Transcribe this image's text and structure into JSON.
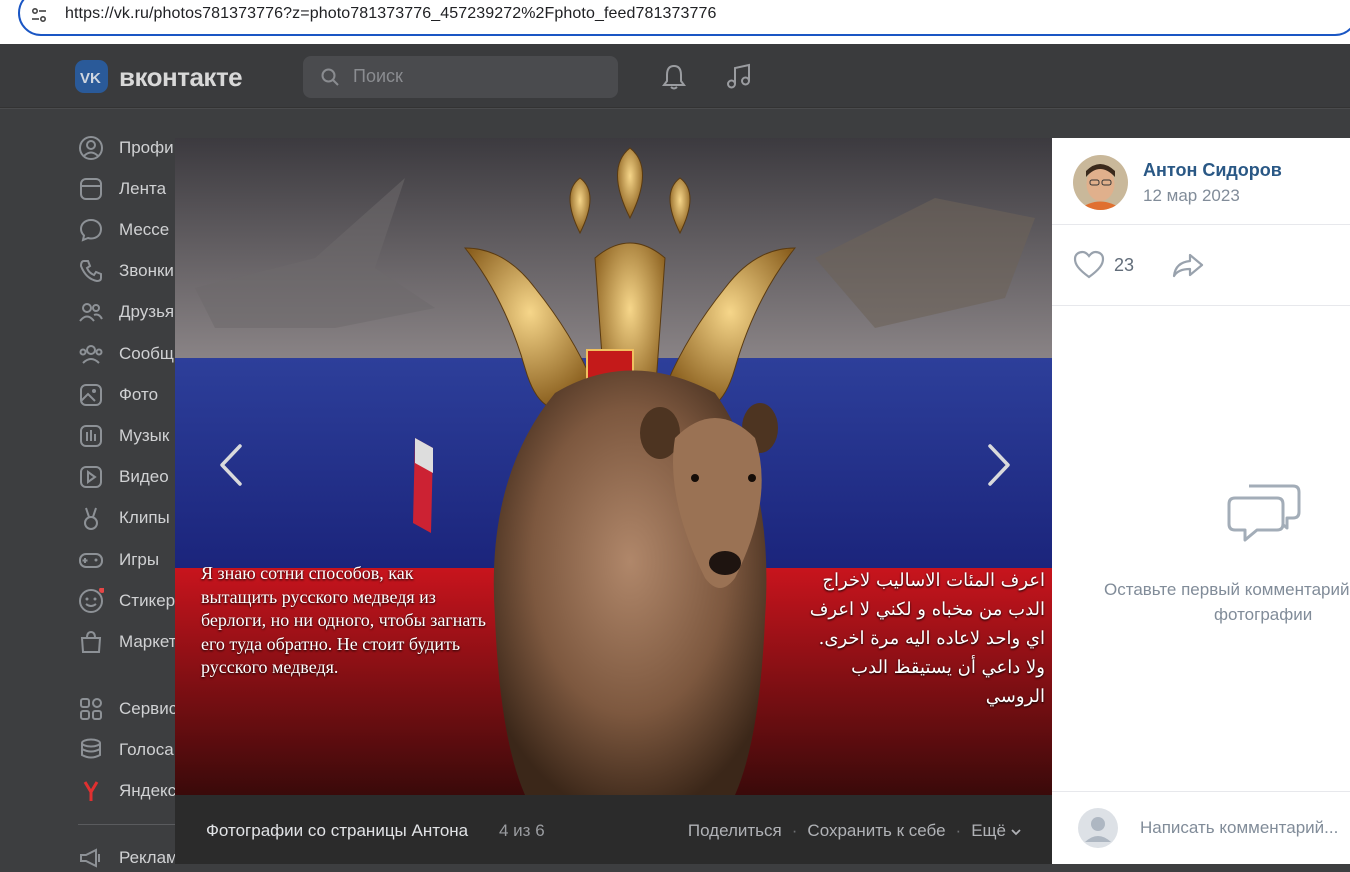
{
  "browser": {
    "url": "https://vk.ru/photos781373776?z=photo781373776_457239272%2Fphoto_feed781373776"
  },
  "vk": {
    "logo_text": "вконтакте",
    "search_placeholder": "Поиск",
    "sidebar": [
      {
        "label": "Профи",
        "icon": "profile-icon"
      },
      {
        "label": "Лента",
        "icon": "feed-icon"
      },
      {
        "label": "Мессе",
        "icon": "messenger-icon"
      },
      {
        "label": "Звонки",
        "icon": "phone-icon"
      },
      {
        "label": "Друзья",
        "icon": "friends-icon"
      },
      {
        "label": "Сообщ",
        "icon": "communities-icon"
      },
      {
        "label": "Фото",
        "icon": "photo-icon"
      },
      {
        "label": "Музык",
        "icon": "music-icon"
      },
      {
        "label": "Видео",
        "icon": "video-icon"
      },
      {
        "label": "Клипы",
        "icon": "clips-icon"
      },
      {
        "label": "Игры",
        "icon": "games-icon"
      },
      {
        "label": "Стикер",
        "icon": "stickers-icon"
      },
      {
        "label": "Маркет",
        "icon": "market-icon"
      },
      {
        "label": "Сервис",
        "icon": "services-icon"
      },
      {
        "label": "Голоса",
        "icon": "votes-icon"
      },
      {
        "label": "Яндекс",
        "icon": "yandex-icon"
      },
      {
        "label": "Реклам",
        "icon": "ads-icon"
      }
    ]
  },
  "viewer": {
    "caption_left": "Я знаю сотни способов, как вытащить русского медведя из берлоги, но ни одного, чтобы загнать его туда обратно. Не стоит будить русского медведя.",
    "caption_right_lines": [
      "اعرف المئات الاساليب لاخراج",
      "الدب من مخباه و لكني لا اعرف",
      "اي واحد لاعاده اليه مرة اخرى.",
      "ولا داعي أن يستيقظ الدب",
      "الروسي"
    ],
    "footer": {
      "album": "Фотографии со страницы Антона",
      "counter": "4 из 6",
      "share": "Поделиться",
      "save": "Сохранить к себе",
      "more": "Ещё"
    }
  },
  "panel": {
    "author_name": "Антон Сидоров",
    "date": "12 мар 2023",
    "likes": "23",
    "empty_line1": "Оставьте первый комментарий",
    "empty_line2": "фотографии",
    "comment_placeholder": "Написать комментарий..."
  },
  "colors": {
    "accent": "#2a5885",
    "link_blue": "#1a56c4",
    "vk_blue": "#0077ff"
  }
}
